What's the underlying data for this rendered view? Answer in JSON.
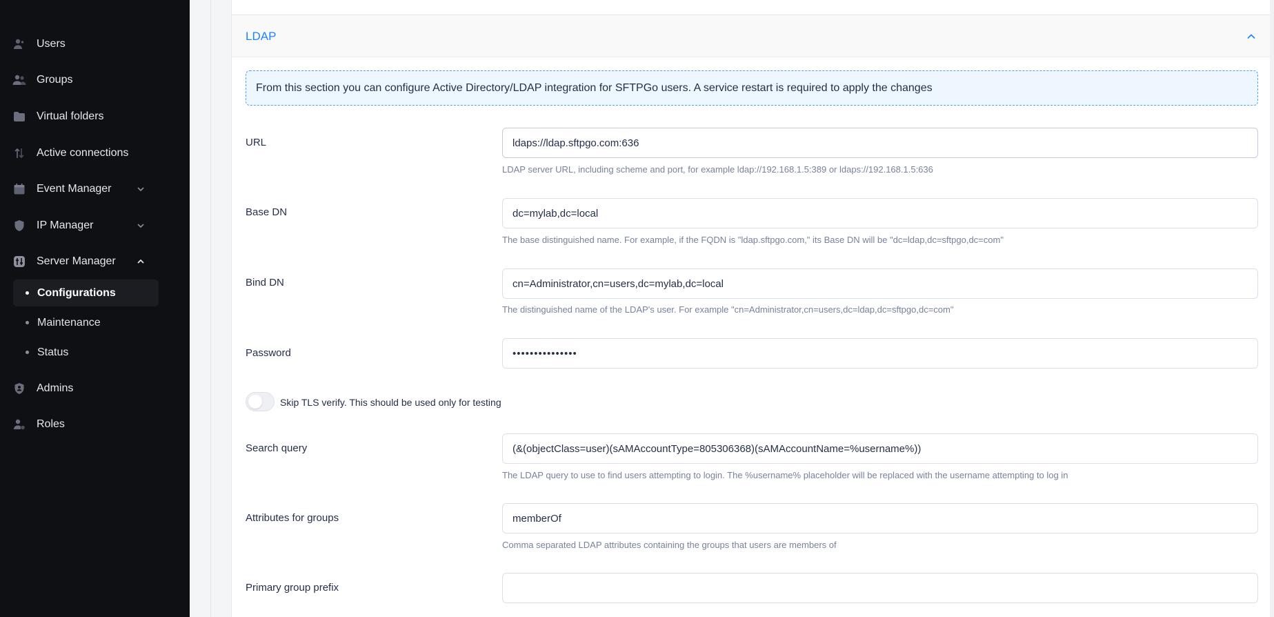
{
  "sidebar": {
    "items": [
      {
        "label": "Users",
        "icon": "user-icon"
      },
      {
        "label": "Groups",
        "icon": "group-icon"
      },
      {
        "label": "Virtual folders",
        "icon": "folder-icon"
      },
      {
        "label": "Active connections",
        "icon": "arrows-icon"
      },
      {
        "label": "Event Manager",
        "icon": "calendar-icon"
      },
      {
        "label": "IP Manager",
        "icon": "shield-icon"
      },
      {
        "label": "Server Manager",
        "icon": "sliders-icon"
      },
      {
        "label": "Admins",
        "icon": "shield-user-icon"
      },
      {
        "label": "Roles",
        "icon": "user-tag-icon"
      }
    ],
    "server_manager_sub": [
      {
        "label": "Configurations"
      },
      {
        "label": "Maintenance"
      },
      {
        "label": "Status"
      }
    ]
  },
  "section": {
    "title": "LDAP",
    "info": "From this section you can configure Active Directory/LDAP integration for SFTPGo users. A service restart is required to apply the changes"
  },
  "fields": {
    "url": {
      "label": "URL",
      "value": "ldaps://ldap.sftpgo.com:636",
      "hint": "LDAP server URL, including scheme and port, for example ldap://192.168.1.5:389 or ldaps://192.168.1.5:636"
    },
    "base_dn": {
      "label": "Base DN",
      "value": "dc=mylab,dc=local",
      "hint": "The base distinguished name. For example, if the FQDN is \"ldap.sftpgo.com,\" its Base DN will be \"dc=ldap,dc=sftpgo,dc=com\""
    },
    "bind_dn": {
      "label": "Bind DN",
      "value": "cn=Administrator,cn=users,dc=mylab,dc=local",
      "hint": "The distinguished name of the LDAP's user. For example \"cn=Administrator,cn=users,dc=ldap,dc=sftpgo,dc=com\""
    },
    "password": {
      "label": "Password",
      "value": "•••••••••••••••"
    },
    "skip_tls": {
      "label": "Skip TLS verify. This should be used only for testing",
      "checked": false
    },
    "search_query": {
      "label": "Search query",
      "value": "(&(objectClass=user)(sAMAccountType=805306368)(sAMAccountName=%username%))",
      "hint": "The LDAP query to use to find users attempting to login. The %username% placeholder will be replaced with the username attempting to log in"
    },
    "group_attributes": {
      "label": "Attributes for groups",
      "value": "memberOf",
      "hint": "Comma separated LDAP attributes containing the groups that users are members of"
    },
    "primary_group_prefix": {
      "label": "Primary group prefix",
      "value": ""
    }
  },
  "colors": {
    "sidebar_bg": "#0f1014",
    "accent": "#1b84ff",
    "info_bg": "#eef6ff"
  }
}
